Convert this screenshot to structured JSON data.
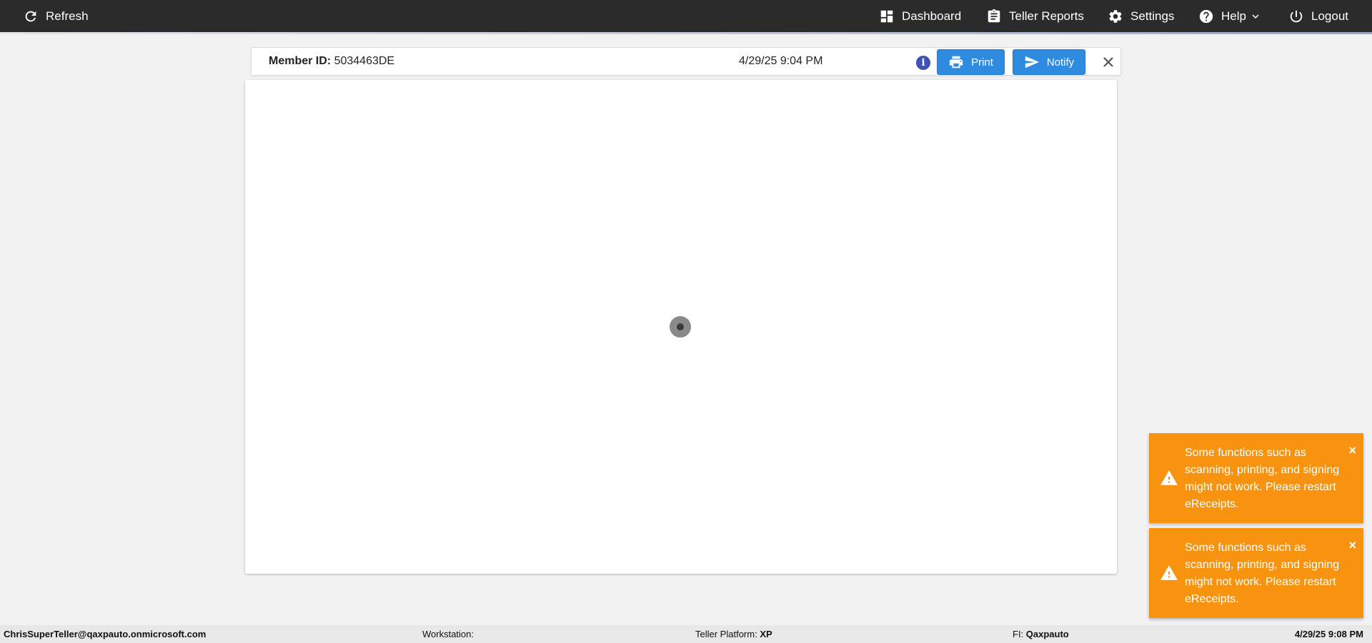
{
  "topbar": {
    "refresh_label": "Refresh",
    "nav": {
      "dashboard": "Dashboard",
      "teller_reports": "Teller Reports",
      "settings": "Settings",
      "help": "Help",
      "logout": "Logout"
    }
  },
  "receipt": {
    "member_label": "Member ID:",
    "member_id": "5034463DE",
    "timestamp": "4/29/25 9:04 PM",
    "info_glyph": "i",
    "print_label": "Print",
    "notify_label": "Notify"
  },
  "toasts": [
    {
      "message": "Some functions such as scanning, printing, and signing might not work. Please restart eReceipts.",
      "close": "×"
    },
    {
      "message": "Some functions such as scanning, printing, and signing might not work. Please restart eReceipts.",
      "close": "×"
    }
  ],
  "footer": {
    "user": "ChrisSuperTeller@qaxpauto.onmicrosoft.com",
    "workstation_label": "Workstation:",
    "workstation_value": "",
    "teller_platform_label": "Teller Platform:",
    "teller_platform_value": "XP",
    "fi_label": "FI:",
    "fi_value": "Qaxpauto",
    "datetime": "4/29/25 9:08 PM"
  },
  "colors": {
    "topbar": "#2b2b2b",
    "button_blue": "#2f8be0",
    "toast_orange": "#f7930e",
    "info_icon": "#3f51b5"
  }
}
